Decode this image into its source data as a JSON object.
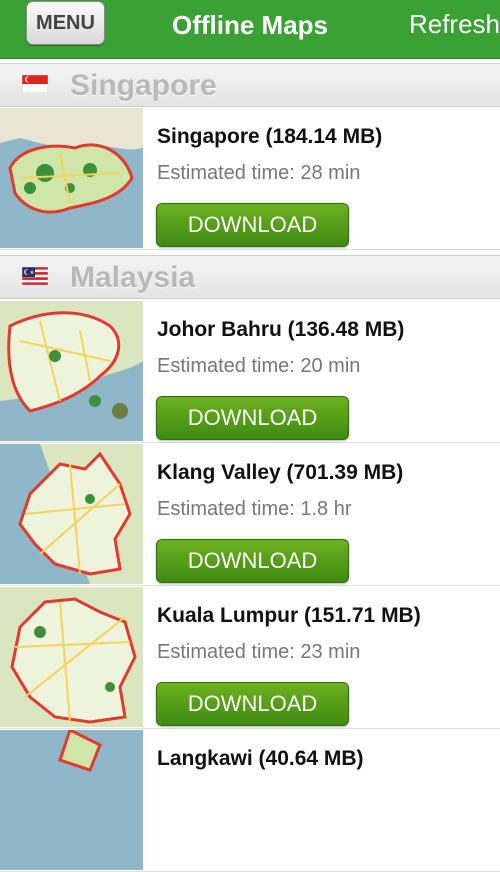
{
  "navbar": {
    "menu_label": "MENU",
    "title": "Offline Maps",
    "refresh_label": "Refresh"
  },
  "colors": {
    "navbar": "#3aa134",
    "button": "#4d9a16",
    "section_text": "#b9b9b9"
  },
  "sections": [
    {
      "name": "Singapore",
      "flag_icon": "singapore-flag-icon",
      "items": [
        {
          "title": "Singapore (184.14 MB)",
          "estimate": "Estimated time: 28 min",
          "button": "DOWNLOAD"
        }
      ]
    },
    {
      "name": "Malaysia",
      "flag_icon": "malaysia-flag-icon",
      "items": [
        {
          "title": "Johor Bahru (136.48 MB)",
          "estimate": "Estimated time: 20 min",
          "button": "DOWNLOAD"
        },
        {
          "title": "Klang Valley (701.39 MB)",
          "estimate": "Estimated time: 1.8 hr",
          "button": "DOWNLOAD"
        },
        {
          "title": "Kuala Lumpur (151.71 MB)",
          "estimate": "Estimated time: 23 min",
          "button": "DOWNLOAD"
        },
        {
          "title": "Langkawi (40.64 MB)",
          "estimate": "",
          "button": ""
        }
      ]
    }
  ]
}
